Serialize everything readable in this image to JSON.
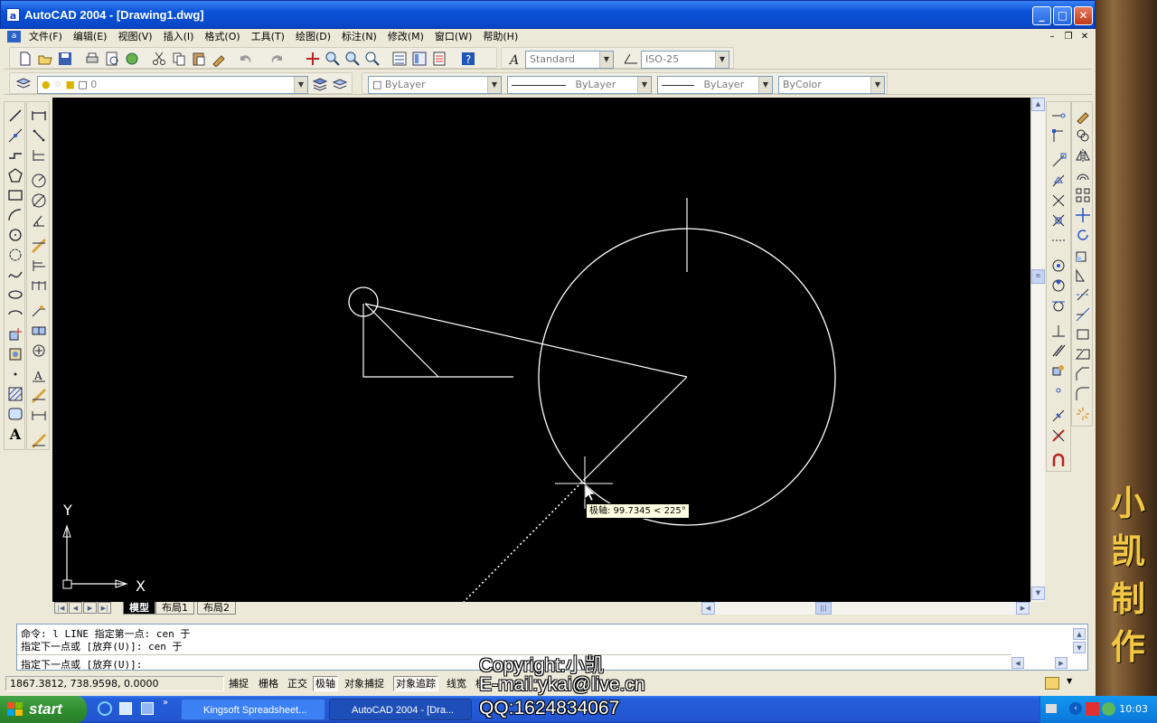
{
  "window": {
    "title": "AutoCAD 2004 - [Drawing1.dwg]",
    "app_icon": "a"
  },
  "menu": [
    "文件(F)",
    "编辑(E)",
    "视图(V)",
    "插入(I)",
    "格式(O)",
    "工具(T)",
    "绘图(D)",
    "标注(N)",
    "修改(M)",
    "窗口(W)",
    "帮助(H)"
  ],
  "toolbar": {
    "text_style": "Standard",
    "dim_style": "ISO-25"
  },
  "layers": {
    "current_layer": "0",
    "color": "ByLayer",
    "linetype": "ByLayer",
    "lineweight": "ByLayer",
    "plot_style": "ByColor"
  },
  "canvas": {
    "tooltip": "极轴: 99.7345 < 225°",
    "ucs_x": "X",
    "ucs_y": "Y"
  },
  "layout_tabs": [
    "模型",
    "布局1",
    "布局2"
  ],
  "command": {
    "lines": [
      "命令: l LINE 指定第一点: cen 于",
      "指定下一点或 [放弃(U)]: cen 于"
    ],
    "prompt": "指定下一点或 [放弃(U)]:"
  },
  "status": {
    "coords": "1867.3812, 738.9598, 0.0000",
    "buttons": [
      "捕捉",
      "栅格",
      "正交",
      "极轴",
      "对象捕捉",
      "对象追踪",
      "线宽",
      "模型"
    ]
  },
  "taskbar": {
    "start": "start",
    "tasks": [
      "Kingsoft Spreadsheet...",
      "AutoCAD 2004 - [Dra..."
    ],
    "clock": "10:03"
  },
  "watermark": {
    "copyright": "Copyright:小凯",
    "email": "E-mail:ykai@live.cn",
    "qq": "QQ:1624834067",
    "side_text": [
      "小",
      "凯",
      "制",
      "作"
    ]
  },
  "colors": {
    "titlebar": "#0a53d8",
    "canvas": "#000000",
    "taskbar": "#245edb",
    "start": "#2f8f2f",
    "watermark_side": "#f2c842"
  },
  "icons": {
    "left_draw": [
      "line-icon",
      "construction-line-icon",
      "polyline-icon",
      "polygon-icon",
      "rectangle-icon",
      "arc-icon",
      "circle-icon",
      "revision-cloud-icon",
      "spline-icon",
      "ellipse-icon",
      "ellipse-arc-icon",
      "insert-block-icon",
      "make-block-icon",
      "point-icon",
      "hatch-icon",
      "region-icon",
      "multiline-text-icon"
    ]
  }
}
